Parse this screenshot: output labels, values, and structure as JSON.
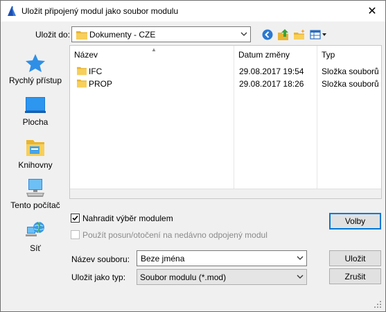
{
  "window": {
    "title": "Uložit připojený modul jako soubor modulu",
    "close_glyph": "✕"
  },
  "toolbar": {
    "save_in_label": "Uložit do:",
    "location": "Dokumenty - CZE",
    "buttons": [
      "back-icon",
      "up-folder-icon",
      "new-folder-icon",
      "view-menu-icon"
    ]
  },
  "places": [
    {
      "label": "Rychlý přístup",
      "icon": "star-icon"
    },
    {
      "label": "Plocha",
      "icon": "desktop-icon"
    },
    {
      "label": "Knihovny",
      "icon": "libraries-icon"
    },
    {
      "label": "Tento počítač",
      "icon": "computer-icon"
    },
    {
      "label": "Síť",
      "icon": "network-icon"
    }
  ],
  "file_list": {
    "columns": [
      "Název",
      "Datum změny",
      "Typ"
    ],
    "rows": [
      {
        "name": "IFC",
        "date": "29.08.2017 19:54",
        "type": "Složka souborů"
      },
      {
        "name": "PROP",
        "date": "29.08.2017 18:26",
        "type": "Složka souborů"
      }
    ]
  },
  "options": {
    "replace_selection": {
      "label": "Nahradit výběr modulem",
      "checked": true
    },
    "use_offset": {
      "label": "Použít posun/otočení na nedávno odpojený modul",
      "checked": false,
      "enabled": false
    },
    "options_button": "Volby"
  },
  "form": {
    "filename_label": "Název souboru:",
    "filename_value": "Beze jména",
    "filetype_label": "Uložit jako typ:",
    "filetype_value": "Soubor modulu (*.mod)",
    "save_button": "Uložit",
    "cancel_button": "Zrušit"
  },
  "colors": {
    "accent": "#0078d7",
    "folder": "#f5c342",
    "star": "#2f8fe6"
  }
}
